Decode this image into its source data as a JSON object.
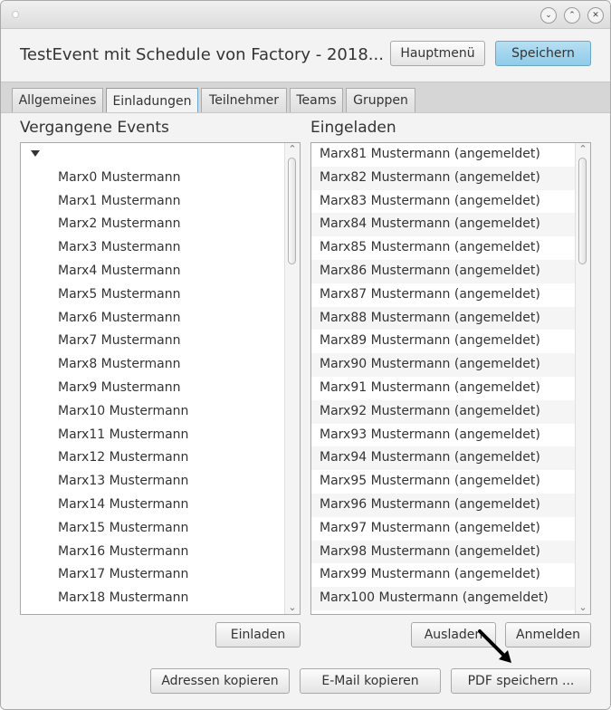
{
  "header": {
    "title": "TestEvent mit Schedule von Factory - 2018...",
    "main_menu_label": "Hauptmenü",
    "save_label": "Speichern"
  },
  "tabs": [
    {
      "label": "Allgemeines",
      "active": false
    },
    {
      "label": "Einladungen",
      "active": true
    },
    {
      "label": "Teilnehmer",
      "active": false
    },
    {
      "label": "Teams",
      "active": false
    },
    {
      "label": "Gruppen",
      "active": false
    }
  ],
  "past_events": {
    "label": "Vergangene Events",
    "items": [
      "Marx0 Mustermann",
      "Marx1 Mustermann",
      "Marx2 Mustermann",
      "Marx3 Mustermann",
      "Marx4 Mustermann",
      "Marx5 Mustermann",
      "Marx6 Mustermann",
      "Marx7 Mustermann",
      "Marx8 Mustermann",
      "Marx9 Mustermann",
      "Marx10 Mustermann",
      "Marx11 Mustermann",
      "Marx12 Mustermann",
      "Marx13 Mustermann",
      "Marx14 Mustermann",
      "Marx15 Mustermann",
      "Marx16 Mustermann",
      "Marx17 Mustermann",
      "Marx18 Mustermann"
    ],
    "invite_label": "Einladen"
  },
  "invited": {
    "label": "Eingeladen",
    "items": [
      "Marx81 Mustermann (angemeldet)",
      "Marx82 Mustermann (angemeldet)",
      "Marx83 Mustermann (angemeldet)",
      "Marx84 Mustermann (angemeldet)",
      "Marx85 Mustermann (angemeldet)",
      "Marx86 Mustermann (angemeldet)",
      "Marx87 Mustermann (angemeldet)",
      "Marx88 Mustermann (angemeldet)",
      "Marx89 Mustermann (angemeldet)",
      "Marx90 Mustermann (angemeldet)",
      "Marx91 Mustermann (angemeldet)",
      "Marx92 Mustermann (angemeldet)",
      "Marx93 Mustermann (angemeldet)",
      "Marx94 Mustermann (angemeldet)",
      "Marx95 Mustermann (angemeldet)",
      "Marx96 Mustermann (angemeldet)",
      "Marx97 Mustermann (angemeldet)",
      "Marx98 Mustermann (angemeldet)",
      "Marx99 Mustermann (angemeldet)",
      "Marx100 Mustermann (angemeldet)"
    ],
    "uninvite_label": "Ausladen",
    "register_label": "Anmelden"
  },
  "footer": {
    "copy_addresses_label": "Adressen kopieren",
    "copy_email_label": "E-Mail kopieren",
    "save_pdf_label": "PDF speichern ..."
  }
}
